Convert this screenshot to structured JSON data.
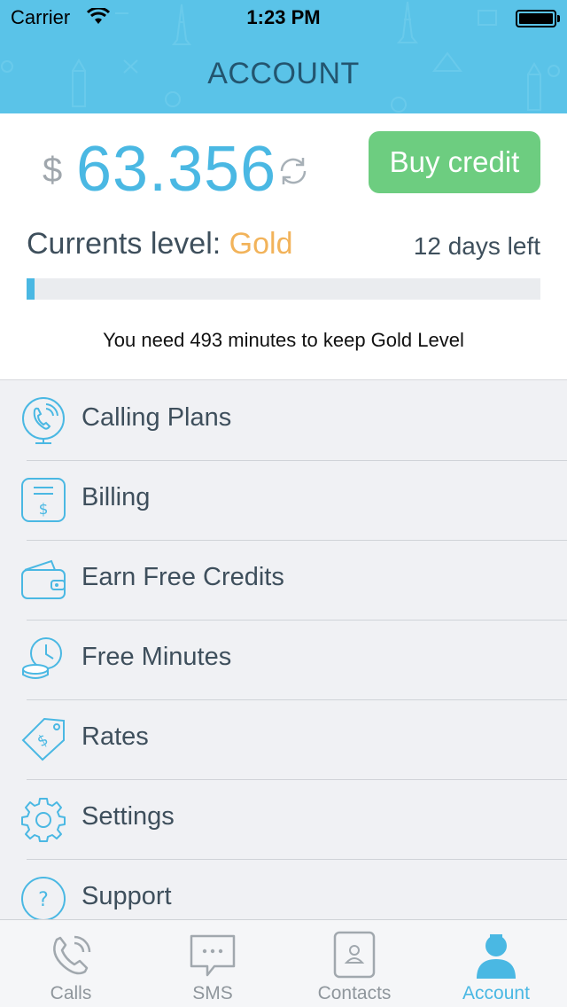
{
  "status_bar": {
    "carrier": "Carrier",
    "time": "1:23 PM"
  },
  "header": {
    "title": "ACCOUNT"
  },
  "balance": {
    "currency": "$",
    "amount": "63.356",
    "buy_label": "Buy credit"
  },
  "level": {
    "prefix": "Currents level:",
    "name": "Gold",
    "days_left": "12 days left",
    "progress_fraction": 0.015,
    "note": "You need 493 minutes to keep Gold Level"
  },
  "menu": {
    "items": [
      {
        "label": "Calling Plans",
        "icon": "calling-plans-icon"
      },
      {
        "label": "Billing",
        "icon": "billing-icon"
      },
      {
        "label": "Earn Free Credits",
        "icon": "wallet-icon"
      },
      {
        "label": "Free Minutes",
        "icon": "clock-coins-icon"
      },
      {
        "label": "Rates",
        "icon": "price-tag-icon"
      },
      {
        "label": "Settings",
        "icon": "gear-icon"
      },
      {
        "label": "Support",
        "icon": "help-icon"
      }
    ]
  },
  "tabs": [
    {
      "label": "Calls",
      "icon": "phone-icon"
    },
    {
      "label": "SMS",
      "icon": "chat-bubble-icon"
    },
    {
      "label": "Contacts",
      "icon": "contact-card-icon"
    },
    {
      "label": "Account",
      "icon": "person-icon",
      "active": true
    }
  ],
  "colors": {
    "header_bg": "#5ac3e8",
    "accent": "#4ab8e3",
    "buy_button": "#6dcd80",
    "level_gold": "#f2b35a",
    "text_dark": "#3e4f5c"
  }
}
